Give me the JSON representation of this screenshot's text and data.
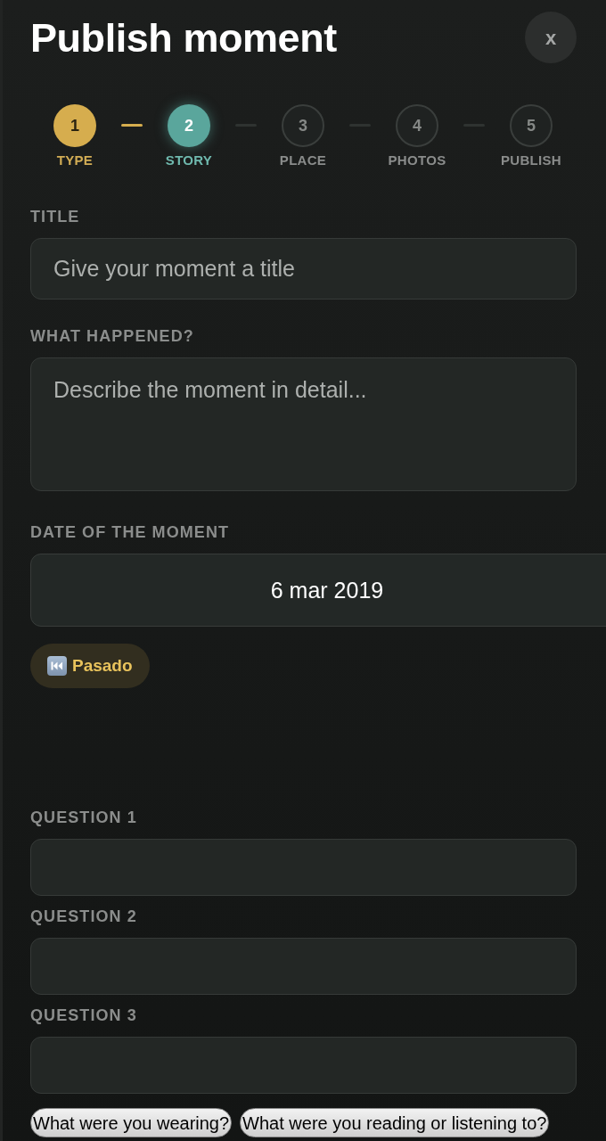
{
  "header": {
    "title": "Publish moment",
    "close_label": "x"
  },
  "steps": [
    {
      "number": "1",
      "label": "TYPE",
      "completed": true,
      "selected": false
    },
    {
      "number": "2",
      "label": "STORY",
      "completed": false,
      "selected": true
    },
    {
      "number": "3",
      "label": "PLACE",
      "completed": false,
      "selected": false
    },
    {
      "number": "4",
      "label": "PHOTOS",
      "completed": false,
      "selected": false
    },
    {
      "number": "5",
      "label": "PUBLISH",
      "completed": false,
      "selected": false
    }
  ],
  "fields": [
    {
      "kind": "input",
      "label": "TITLE",
      "placeholder": "Give your moment a title"
    },
    {
      "kind": "textarea",
      "label": "WHAT HAPPENED?",
      "placeholder": "Describe the moment in detail..."
    }
  ],
  "date": {
    "label": "DATE OF THE MOMENT",
    "value": "6 mar 2019"
  },
  "time_tag": {
    "label": "Pasado"
  },
  "questions": [
    {
      "label": "QUESTION 1"
    },
    {
      "label": "QUESTION 2"
    },
    {
      "label": "QUESTION 3"
    }
  ],
  "suggestions": [
    "What were you wearing?",
    "What were you reading or listening to?"
  ]
}
